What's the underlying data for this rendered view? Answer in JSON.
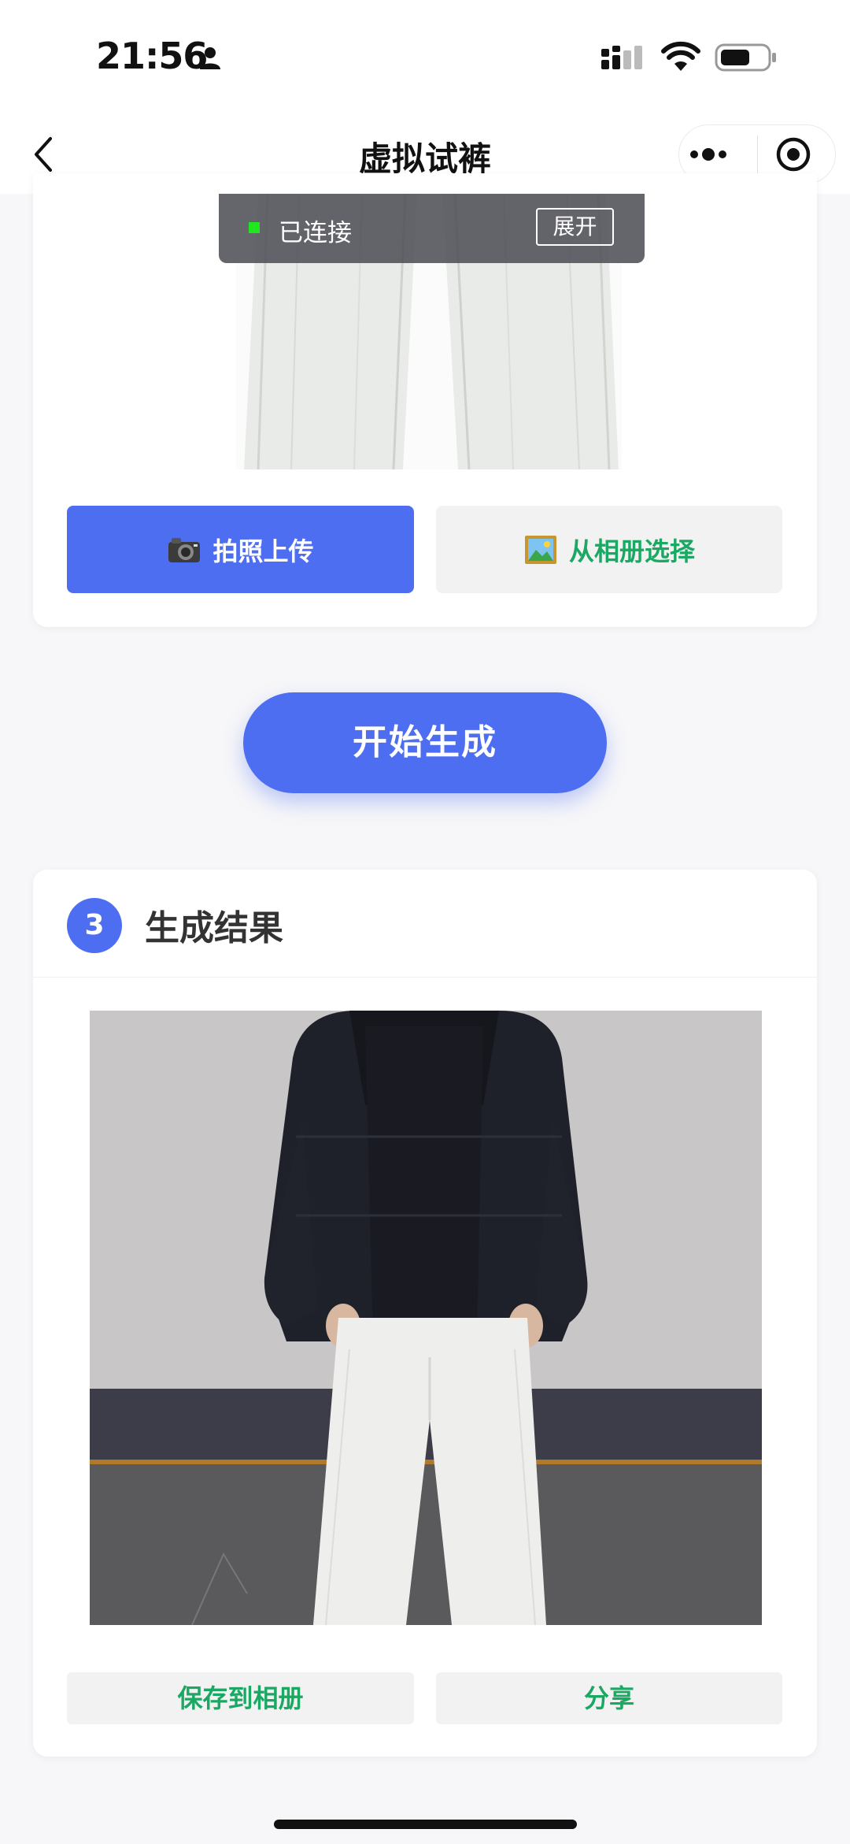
{
  "status_bar": {
    "time": "21:56"
  },
  "nav": {
    "title": "虚拟试裤"
  },
  "connection": {
    "status_label": "已连接",
    "expand_label": "展开"
  },
  "upload": {
    "take_photo_label": "拍照上传",
    "choose_album_label": "从相册选择"
  },
  "generate": {
    "button_label": "开始生成"
  },
  "result": {
    "step_number": "3",
    "title": "生成结果",
    "save_label": "保存到相册",
    "share_label": "分享"
  },
  "colors": {
    "primary": "#4e6ef2",
    "accent_green": "#1aa863",
    "connected_dot": "#1fe61f"
  },
  "icons": {
    "back": "back-icon",
    "more": "more-icon",
    "close_miniprogram": "target-icon",
    "camera": "camera-icon",
    "album": "picture-icon",
    "person": "person-icon",
    "signal": "signal-icon",
    "wifi": "wifi-icon",
    "battery": "battery-icon"
  }
}
